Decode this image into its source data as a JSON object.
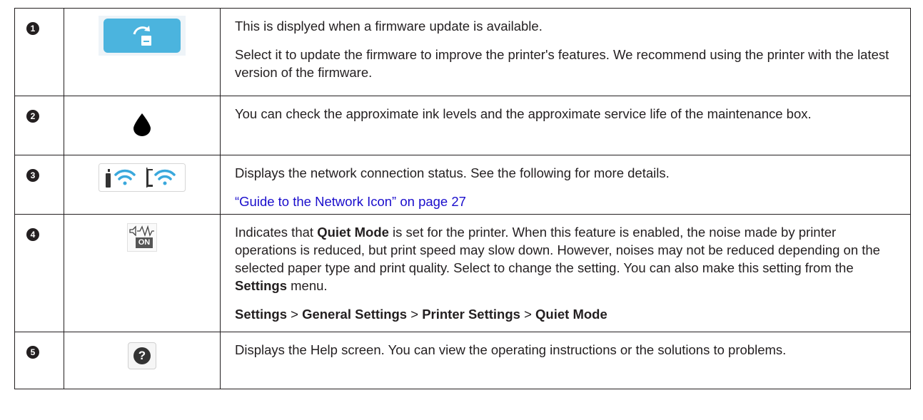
{
  "rows": [
    {
      "num": "1",
      "icon": "firmware-update-icon",
      "paragraphs": [
        "This is displyed when a firmware update is available.",
        "Select it to update the firmware to improve the printer's features. We recommend using the printer with the latest version of the firmware."
      ]
    },
    {
      "num": "2",
      "icon": "ink-drop-icon",
      "paragraphs": [
        "You can check the approximate ink levels and the approximate service life of the maintenance box."
      ]
    },
    {
      "num": "3",
      "icon": "network-status-icon",
      "paragraphs": [
        "Displays the network connection status. See the following for more details."
      ],
      "link": "“Guide to the Network Icon” on page 27"
    },
    {
      "num": "4",
      "icon": "quiet-mode-icon",
      "icon_badge": "ON",
      "text_a": "Indicates that ",
      "bold_a": "Quiet Mode",
      "text_b": " is set for the printer. When this feature is enabled, the noise made by printer operations is reduced, but print speed may slow down. However, noises may not be reduced depending on the selected paper type and print quality. Select to change the setting. You can also make this setting from the ",
      "bold_b": "Settings",
      "text_c": " menu.",
      "path": [
        "Settings",
        "General Settings",
        "Printer Settings",
        "Quiet Mode"
      ],
      "path_sep": " > "
    },
    {
      "num": "5",
      "icon": "help-icon",
      "icon_glyph": "?",
      "paragraphs": [
        "Displays the Help screen. You can view the operating instructions or the solutions to problems."
      ]
    }
  ],
  "colors": {
    "firmware_bg": "#4bb4de",
    "network_blue": "#3aa8dc",
    "text": "#231f20",
    "link": "#1a0dcc"
  }
}
